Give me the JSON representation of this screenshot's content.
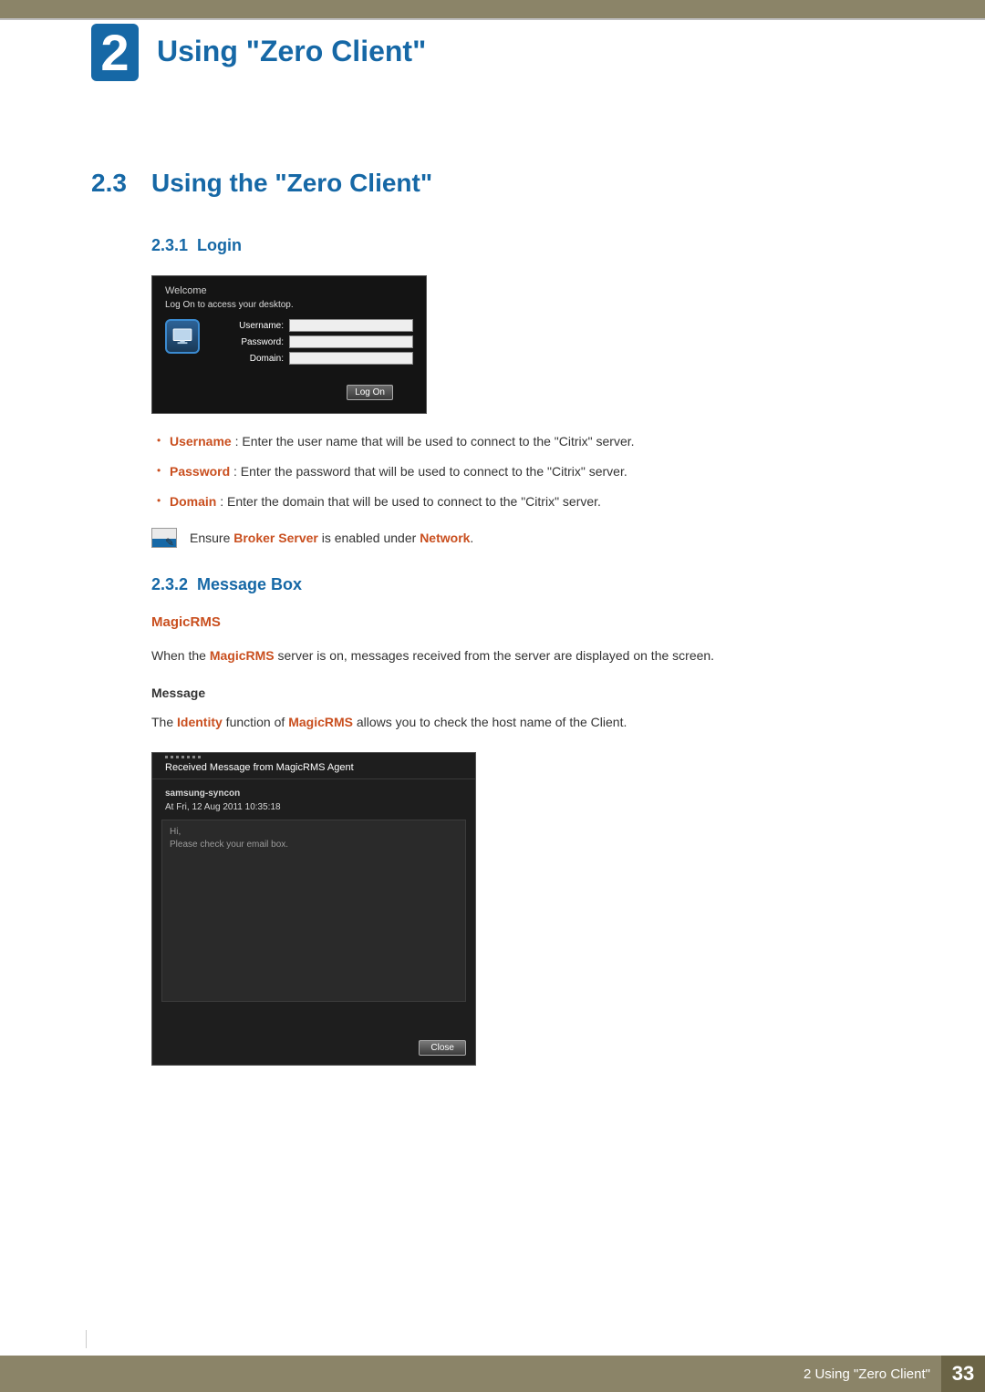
{
  "chapter": {
    "number": "2",
    "title": "Using \"Zero Client\""
  },
  "section": {
    "number": "2.3",
    "title": "Using the \"Zero Client\""
  },
  "s231": {
    "number": "2.3.1",
    "title": "Login",
    "welcome": "Welcome",
    "logon_prompt": "Log On to access your desktop.",
    "labels": {
      "username": "Username:",
      "password": "Password:",
      "domain": "Domain:"
    },
    "logon_button": "Log On",
    "bullets": [
      {
        "term": "Username",
        "desc": " : Enter the user name that will be used to connect to the \"Citrix\" server."
      },
      {
        "term": "Password",
        "desc": " : Enter the password that will be used to connect to the \"Citrix\" server."
      },
      {
        "term": "Domain",
        "desc": " : Enter the domain that will be used to connect to the \"Citrix\" server."
      }
    ],
    "note_pre": "Ensure ",
    "note_term1": "Broker Server",
    "note_mid": " is enabled under ",
    "note_term2": "Network",
    "note_post": "."
  },
  "s232": {
    "number": "2.3.2",
    "title": "Message Box",
    "magicrms": "MagicRMS",
    "magicrms_sentence_pre": "When the ",
    "magicrms_sentence_term": "MagicRMS",
    "magicrms_sentence_post": " server is on, messages received from the server are displayed on the screen.",
    "message_heading": "Message",
    "identity_pre": "The ",
    "identity_term1": "Identity",
    "identity_mid": " function of ",
    "identity_term2": "MagicRMS",
    "identity_post": " allows you to check the host name of the Client.",
    "dialog": {
      "title": "Received Message from MagicRMS Agent",
      "from": "samsung-syncon",
      "date": "At Fri, 12 Aug 2011 10:35:18",
      "body_line1": "Hi,",
      "body_line2": "Please check your email box.",
      "close": "Close"
    }
  },
  "footer": {
    "label": "2 Using \"Zero Client\"",
    "page": "33"
  }
}
